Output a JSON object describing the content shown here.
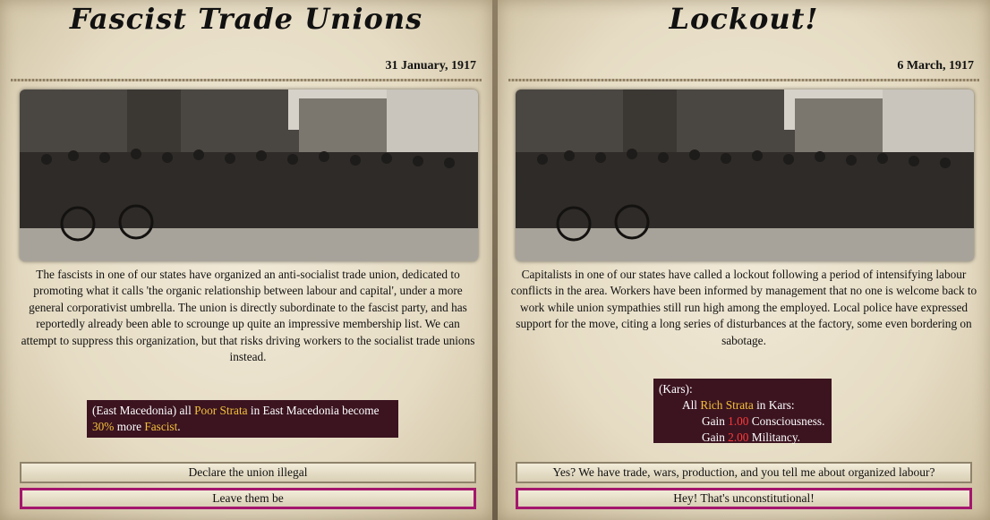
{
  "events": [
    {
      "title": "Fascist Trade Unions",
      "date": "31 January, 1917",
      "description": "The fascists in one of our states have organized an anti-socialist trade union, dedicated to promoting what it calls 'the organic relationship between labour and capital', under a more general corporativist umbrella. The union is directly subordinate to the fascist party, and has reportedly already been able to scrounge up quite an impressive membership list. We can attempt to suppress this organization, but that risks driving workers to the socialist trade unions instead.",
      "effect": {
        "prefix": "(East Macedonia) all ",
        "group": "Poor Strata",
        "middle": " in East Macedonia become ",
        "amount": "30%",
        "more": " more ",
        "ideology": "Fascist",
        "end": "."
      },
      "options": [
        "Declare the union illegal",
        "Leave them be"
      ]
    },
    {
      "title": "Lockout!",
      "date": "6 March, 1917",
      "description": "Capitalists in one of our states have called a lockout following a period of intensifying labour conflicts in the area. Workers have been informed by management that no one is welcome back to work while union sympathies still run high among the employed. Local police have expressed support for the move, citing a long series of disturbances at the factory, some even bordering on sabotage.",
      "effect": {
        "line1": "(Kars):",
        "all": "All ",
        "group": "Rich Strata",
        "in": " in Kars:",
        "gain1_pre": "Gain ",
        "gain1_val": "1.00",
        "gain1_post": " Consciousness.",
        "gain2_pre": "Gain ",
        "gain2_val": "2.00",
        "gain2_post": " Militancy."
      },
      "options": [
        "Yes? We have trade, wars, production, and you tell me about organized labour?",
        "Hey! That's unconstitutional!"
      ]
    }
  ],
  "colors": {
    "highlight_yellow": "#f3c13a",
    "highlight_red": "#ff3a3a",
    "effect_bg": "#3b1420",
    "selected_border": "#a4166d"
  }
}
